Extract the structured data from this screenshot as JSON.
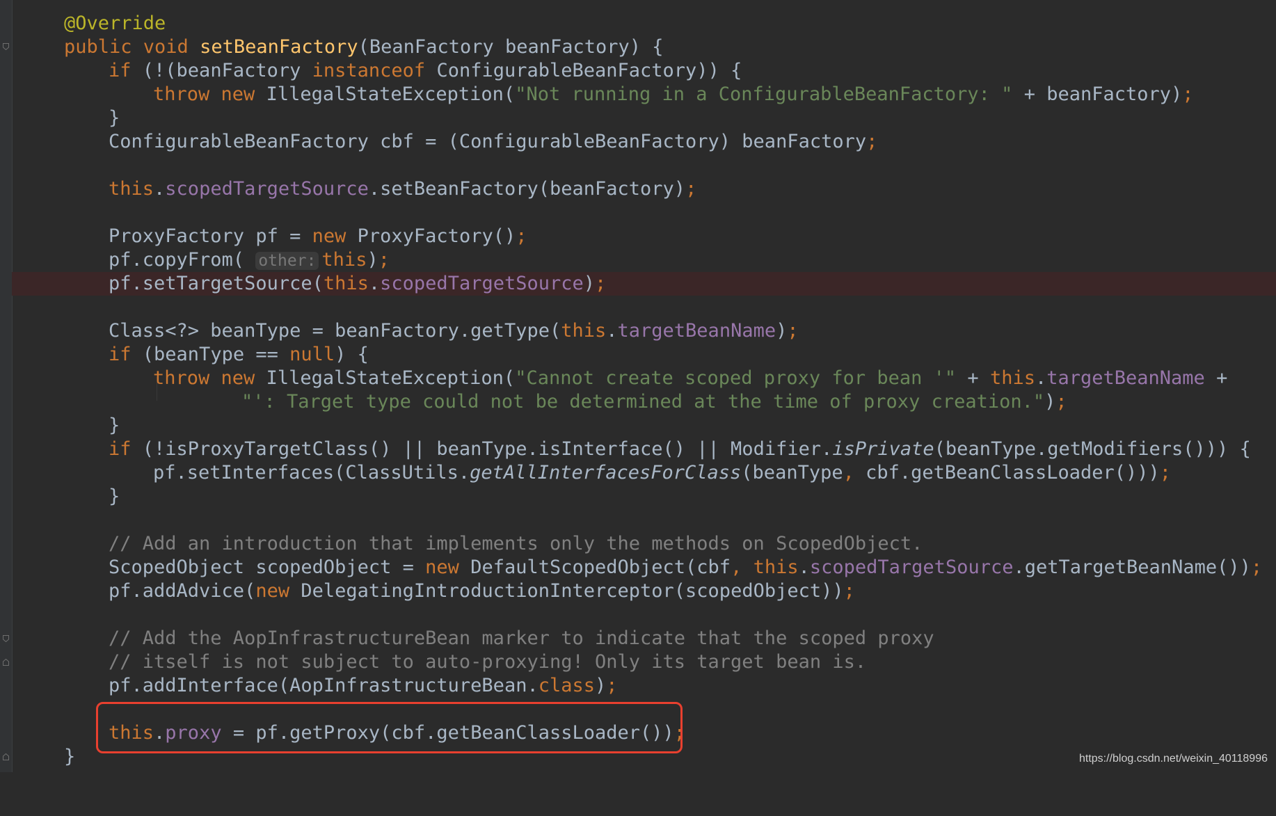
{
  "editor": {
    "hint_label": "other:",
    "lines": {
      "l01": {
        "a": "@Override"
      },
      "l02": {
        "a": "public void ",
        "b": "setBeanFactory",
        "c": "(BeanFactory beanFactory) {"
      },
      "l03": {
        "a": "if ",
        "b": "(!(beanFactory ",
        "c": "instanceof ",
        "d": "ConfigurableBeanFactory)) {"
      },
      "l04": {
        "a": "throw new ",
        "b": "IllegalStateException(",
        "c": "\"Not running in a ConfigurableBeanFactory: \"",
        "d": " + beanFactory)",
        "e": ";"
      },
      "l05": {
        "a": "}"
      },
      "l06": {
        "a": "ConfigurableBeanFactory cbf = (ConfigurableBeanFactory) beanFactory",
        "b": ";"
      },
      "l07": {
        "a": "this",
        "b": ".",
        "c": "scopedTargetSource",
        "d": ".setBeanFactory(beanFactory)",
        "e": ";"
      },
      "l08": {
        "a": "ProxyFactory pf = ",
        "b": "new ",
        "c": "ProxyFactory()",
        "d": ";"
      },
      "l09": {
        "a": "pf.copyFrom( ",
        "c": "this",
        "d": ")",
        "e": ";"
      },
      "l10": {
        "a": "pf.setTargetSource(",
        "b": "this",
        "c": ".",
        "d": "scopedTargetSource",
        "e": ")",
        "f": ";"
      },
      "l11": {
        "a": "Class<?> beanType = beanFactory.getType(",
        "b": "this",
        "c": ".",
        "d": "targetBeanName",
        "e": ")",
        "f": ";"
      },
      "l12": {
        "a": "if ",
        "b": "(beanType == ",
        "c": "null",
        "d": ") {"
      },
      "l13": {
        "a": "throw new ",
        "b": "IllegalStateException(",
        "c": "\"Cannot create scoped proxy for bean '\"",
        "d": " + ",
        "e": "this",
        "f": ".",
        "g": "targetBeanName",
        "h": " +"
      },
      "l14": {
        "a": "\"': Target type could not be determined at the time of proxy creation.\"",
        "b": ")",
        "c": ";"
      },
      "l15": {
        "a": "}"
      },
      "l16": {
        "a": "if ",
        "b": "(!isProxyTargetClass() || beanType.isInterface() || Modifier.",
        "c": "isPrivate",
        "d": "(beanType.getModifiers())) {"
      },
      "l17": {
        "a": "pf.setInterfaces(ClassUtils.",
        "b": "getAllInterfacesForClass",
        "c": "(beanType",
        "d": ", ",
        "e": "cbf.getBeanClassLoader()))",
        "f": ";"
      },
      "l18": {
        "a": "}"
      },
      "l19": {
        "a": "// Add an introduction that implements only the methods on ScopedObject."
      },
      "l20": {
        "a": "ScopedObject scopedObject = ",
        "b": "new ",
        "c": "DefaultScopedObject(cbf",
        "d": ", ",
        "e": "this",
        "f": ".",
        "g": "scopedTargetSource",
        "h": ".getTargetBeanName())",
        "i": ";"
      },
      "l21": {
        "a": "pf.addAdvice(",
        "b": "new ",
        "c": "DelegatingIntroductionInterceptor(scopedObject))",
        "d": ";"
      },
      "l22": {
        "a": "// Add the AopInfrastructureBean marker to indicate that the scoped proxy"
      },
      "l23": {
        "a": "// itself is not subject to auto-proxying! Only its target bean is."
      },
      "l24": {
        "a": "pf.addInterface(AopInfrastructureBean.",
        "b": "class",
        "c": ")",
        "d": ";"
      },
      "l25": {
        "a": "this",
        "b": ".",
        "c": "proxy",
        "d": " = pf.getProxy(cbf.getBeanClassLoader())",
        "e": ";"
      },
      "l26": {
        "a": "}"
      }
    }
  },
  "watermark": "https://blog.csdn.net/weixin_40118996",
  "colors": {
    "background": "#2b2b2b",
    "keyword": "#cc7832",
    "string": "#6a8759",
    "field": "#9876aa",
    "annotation": "#bbb529",
    "method_decl": "#ffc66d",
    "comment": "#808080",
    "highlight_border": "#e8402f"
  }
}
